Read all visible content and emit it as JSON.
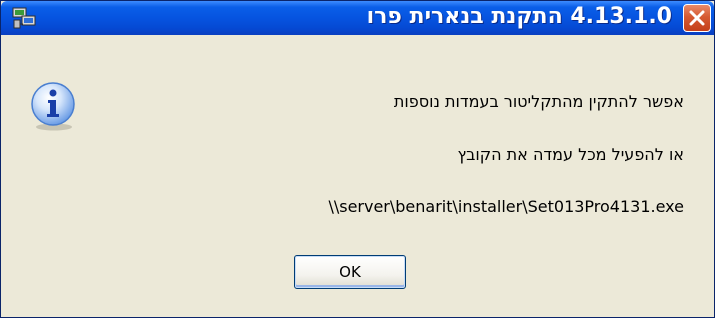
{
  "window": {
    "title": "4.13.1.0 התקנת בנארית פרו"
  },
  "message": {
    "line1": "אפשר להתקין מהתקליטור בעמדות נוספות",
    "line2": "או להפעיל מכל עמדה את הקובץ",
    "path": "\\\\server\\benarit\\installer\\Set013Pro4131.exe"
  },
  "buttons": {
    "ok_label": "OK"
  },
  "icons": {
    "app": "network-computer-icon",
    "info": "information-icon",
    "close": "close-icon"
  },
  "colors": {
    "titlebar": "#0654e0",
    "close_button": "#d65a32",
    "dialog_background": "#ece9d8"
  }
}
